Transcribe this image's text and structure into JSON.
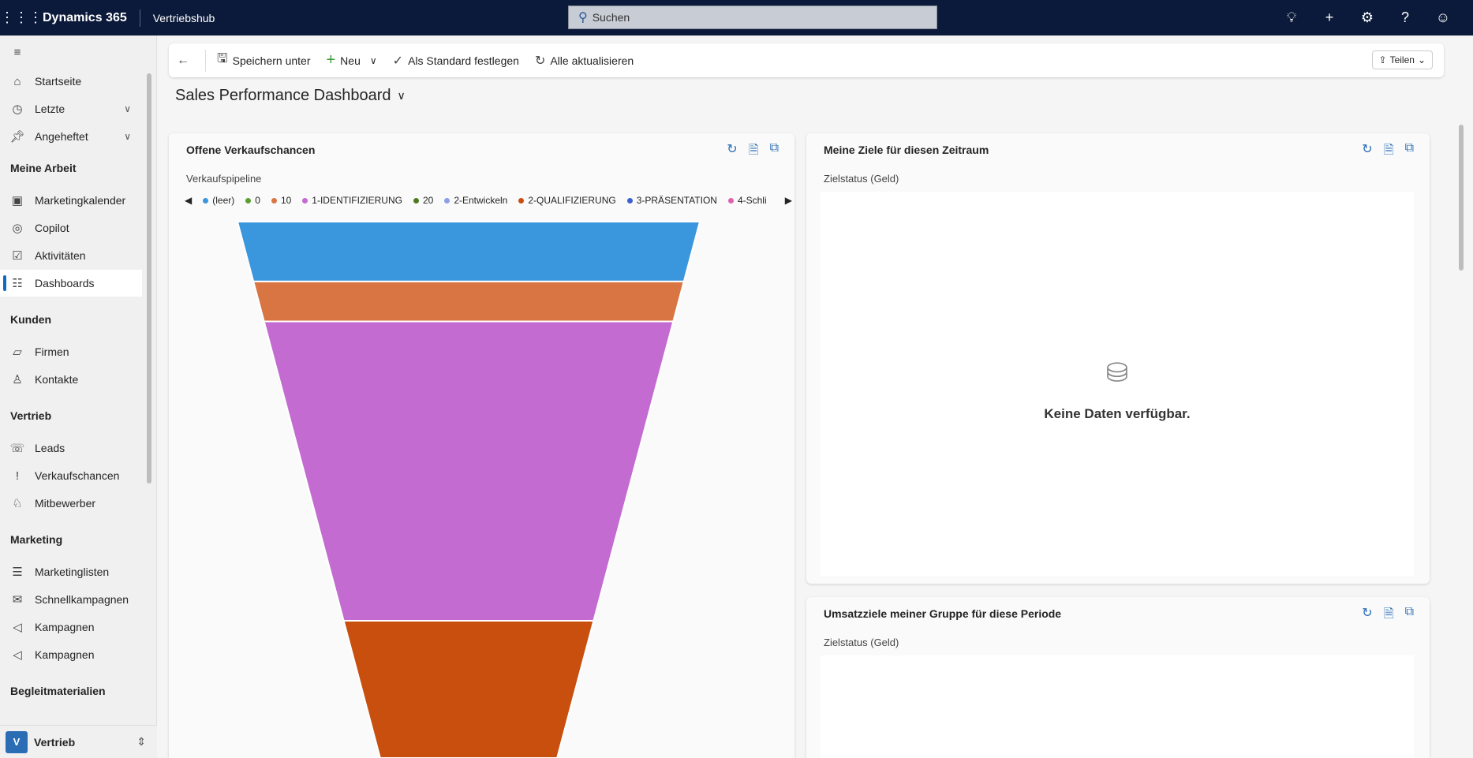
{
  "topbar": {
    "brand": "Dynamics 365",
    "app": "Vertriebshub",
    "search_placeholder": "Suchen",
    "icons": [
      "lightbulb-icon",
      "plus-icon",
      "gear-icon",
      "help-icon",
      "feedback-icon"
    ]
  },
  "sidebar": {
    "items": [
      {
        "label": "Startseite",
        "icon": "home-icon"
      },
      {
        "label": "Letzte",
        "icon": "clock-icon",
        "chevron": true
      },
      {
        "label": "Angeheftet",
        "icon": "pin-icon",
        "chevron": true
      }
    ],
    "sections": [
      {
        "title": "Meine Arbeit",
        "items": [
          {
            "label": "Marketingkalender"
          },
          {
            "label": "Copilot"
          },
          {
            "label": "Aktivitäten"
          },
          {
            "label": "Dashboards",
            "active": true
          }
        ]
      },
      {
        "title": "Kunden",
        "items": [
          {
            "label": "Firmen"
          },
          {
            "label": "Kontakte"
          }
        ]
      },
      {
        "title": "Vertrieb",
        "items": [
          {
            "label": "Leads"
          },
          {
            "label": "Verkaufschancen"
          },
          {
            "label": "Mitbewerber"
          }
        ]
      },
      {
        "title": "Marketing",
        "items": [
          {
            "label": "Marketinglisten"
          },
          {
            "label": "Schnellkampagnen"
          },
          {
            "label": "Kampagnen"
          },
          {
            "label": "Kampagnen"
          }
        ]
      },
      {
        "title": "Begleitmaterialien",
        "items": []
      }
    ],
    "footer": {
      "avatar": "V",
      "label": "Vertrieb"
    }
  },
  "toolbar": {
    "save_as": "Speichern unter",
    "new": "Neu",
    "set_default": "Als Standard festlegen",
    "refresh_all": "Alle aktualisieren",
    "share": "Teilen"
  },
  "page": {
    "title": "Sales Performance Dashboard"
  },
  "cards": {
    "opportunities": {
      "title": "Offene Verkaufschancen",
      "subtitle": "Verkaufspipeline"
    },
    "my_goals": {
      "title": "Meine Ziele für diesen Zeitraum",
      "subtitle": "Zielstatus (Geld)",
      "empty": "Keine Daten verfügbar."
    },
    "team_goals": {
      "title": "Umsatzziele meiner Gruppe für diese Periode",
      "subtitle": "Zielstatus (Geld)"
    }
  },
  "chart_data": {
    "type": "funnel",
    "title": "Verkaufspipeline",
    "legend_position": "top",
    "legend": [
      {
        "name": "(leer)",
        "color": "#3a96dd"
      },
      {
        "name": "0",
        "color": "#5c9e31"
      },
      {
        "name": "10",
        "color": "#d97542"
      },
      {
        "name": "1-IDENTIFIZIERUNG",
        "color": "#c36bd1"
      },
      {
        "name": "20",
        "color": "#4e7a1f"
      },
      {
        "name": "2-Entwickeln",
        "color": "#8c9ee8"
      },
      {
        "name": "2-QUALIFIZIERUNG",
        "color": "#c94f0f"
      },
      {
        "name": "3-PRÄSENTATION",
        "color": "#3f5fd0"
      },
      {
        "name": "4-Schli",
        "color": "#e060b0"
      }
    ],
    "segments": [
      {
        "name": "(leer)",
        "value": 3,
        "color": "#3a96dd"
      },
      {
        "name": "10",
        "value": 2,
        "color": "#d97542"
      },
      {
        "name": "1-IDENTIFIZIERUNG",
        "value": 15,
        "color": "#c36bd1"
      },
      {
        "name": "2-QUALIFIZIERUNG",
        "value": 7,
        "color": "#c94f0f"
      }
    ]
  }
}
